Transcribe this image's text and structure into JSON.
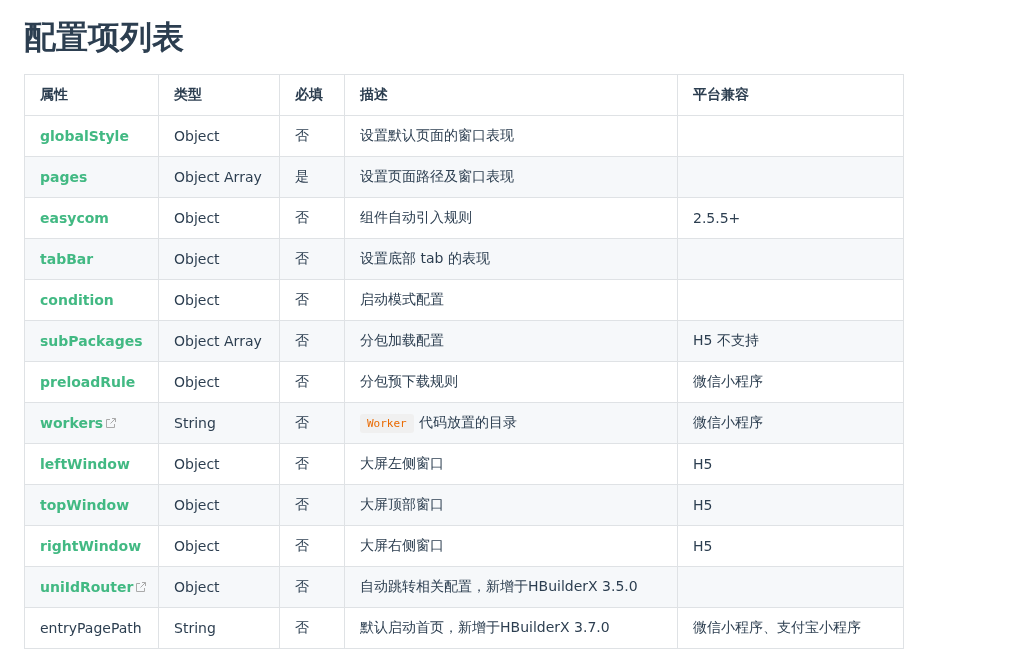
{
  "title": "配置项列表",
  "table": {
    "columns": [
      "属性",
      "类型",
      "必填",
      "描述",
      "平台兼容"
    ],
    "rows": [
      {
        "name": "globalStyle",
        "link": true,
        "external": false,
        "type": "Object",
        "required": "否",
        "description": "设置默认页面的窗口表现",
        "platform": ""
      },
      {
        "name": "pages",
        "link": true,
        "external": false,
        "type": "Object Array",
        "required": "是",
        "description": "设置页面路径及窗口表现",
        "platform": ""
      },
      {
        "name": "easycom",
        "link": true,
        "external": false,
        "type": "Object",
        "required": "否",
        "description": "组件自动引入规则",
        "platform": "2.5.5+"
      },
      {
        "name": "tabBar",
        "link": true,
        "external": false,
        "type": "Object",
        "required": "否",
        "description": "设置底部 tab 的表现",
        "platform": ""
      },
      {
        "name": "condition",
        "link": true,
        "external": false,
        "type": "Object",
        "required": "否",
        "description": "启动模式配置",
        "platform": ""
      },
      {
        "name": "subPackages",
        "link": true,
        "external": false,
        "type": "Object Array",
        "required": "否",
        "description": "分包加载配置",
        "platform": "H5 不支持"
      },
      {
        "name": "preloadRule",
        "link": true,
        "external": false,
        "type": "Object",
        "required": "否",
        "description": "分包预下载规则",
        "platform": "微信小程序"
      },
      {
        "name": "workers",
        "link": true,
        "external": true,
        "type": "String",
        "required": "否",
        "code": "Worker",
        "description": "代码放置的目录",
        "platform": "微信小程序"
      },
      {
        "name": "leftWindow",
        "link": true,
        "external": false,
        "type": "Object",
        "required": "否",
        "description": "大屏左侧窗口",
        "platform": "H5"
      },
      {
        "name": "topWindow",
        "link": true,
        "external": false,
        "type": "Object",
        "required": "否",
        "description": "大屏顶部窗口",
        "platform": "H5"
      },
      {
        "name": "rightWindow",
        "link": true,
        "external": false,
        "type": "Object",
        "required": "否",
        "description": "大屏右侧窗口",
        "platform": "H5"
      },
      {
        "name": "uniIdRouter",
        "link": true,
        "external": true,
        "type": "Object",
        "required": "否",
        "description": "自动跳转相关配置，新增于HBuilderX 3.5.0",
        "platform": ""
      },
      {
        "name": "entryPagePath",
        "link": false,
        "external": false,
        "type": "String",
        "required": "否",
        "description": "默认启动首页，新增于HBuilderX 3.7.0",
        "platform": "微信小程序、支付宝小程序"
      }
    ]
  }
}
